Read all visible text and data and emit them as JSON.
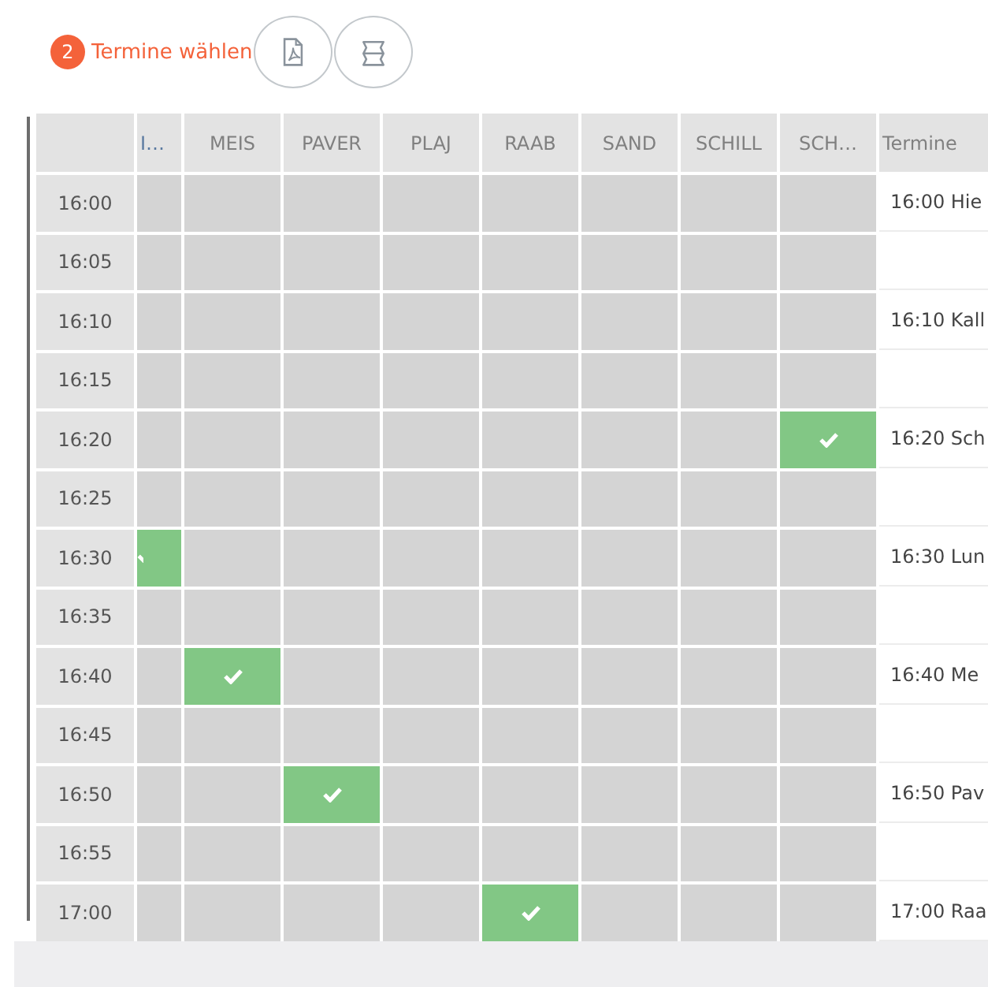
{
  "step": {
    "number": "2",
    "label": "Termine wählen"
  },
  "toolbar": [
    {
      "kind": "pdf"
    },
    {
      "kind": "layout"
    }
  ],
  "table": {
    "columns": [
      "I…",
      "MEIS",
      "PAVER",
      "PLAJ",
      "RAAB",
      "SAND",
      "SCHILL",
      "SCH…"
    ],
    "termine_header": "Termine",
    "rows": [
      {
        "time": "16:00",
        "booked": [
          false,
          false,
          false,
          false,
          false,
          false,
          false,
          false
        ],
        "termin": "16:00 Hie"
      },
      {
        "time": "16:05",
        "booked": [
          false,
          false,
          false,
          false,
          false,
          false,
          false,
          false
        ]
      },
      {
        "time": "16:10",
        "booked": [
          false,
          false,
          false,
          false,
          false,
          false,
          false,
          false
        ],
        "termin": "16:10 Kall"
      },
      {
        "time": "16:15",
        "booked": [
          false,
          false,
          false,
          false,
          false,
          false,
          false,
          false
        ]
      },
      {
        "time": "16:20",
        "booked": [
          false,
          false,
          false,
          false,
          false,
          false,
          false,
          true
        ],
        "termin": "16:20 Sch"
      },
      {
        "time": "16:25",
        "booked": [
          false,
          false,
          false,
          false,
          false,
          false,
          false,
          false
        ]
      },
      {
        "time": "16:30",
        "booked": [
          true,
          false,
          false,
          false,
          false,
          false,
          false,
          false
        ],
        "termin": "16:30 Lun"
      },
      {
        "time": "16:35",
        "booked": [
          false,
          false,
          false,
          false,
          false,
          false,
          false,
          false
        ]
      },
      {
        "time": "16:40",
        "booked": [
          false,
          true,
          false,
          false,
          false,
          false,
          false,
          false
        ],
        "termin": "16:40 Me"
      },
      {
        "time": "16:45",
        "booked": [
          false,
          false,
          false,
          false,
          false,
          false,
          false,
          false
        ]
      },
      {
        "time": "16:50",
        "booked": [
          false,
          false,
          true,
          false,
          false,
          false,
          false,
          false
        ],
        "termin": "16:50 Pav"
      },
      {
        "time": "16:55",
        "booked": [
          false,
          false,
          false,
          false,
          false,
          false,
          false,
          false
        ]
      },
      {
        "time": "17:00",
        "booked": [
          false,
          false,
          false,
          false,
          true,
          false,
          false,
          false
        ],
        "termin": "17:00 Raa"
      }
    ]
  }
}
